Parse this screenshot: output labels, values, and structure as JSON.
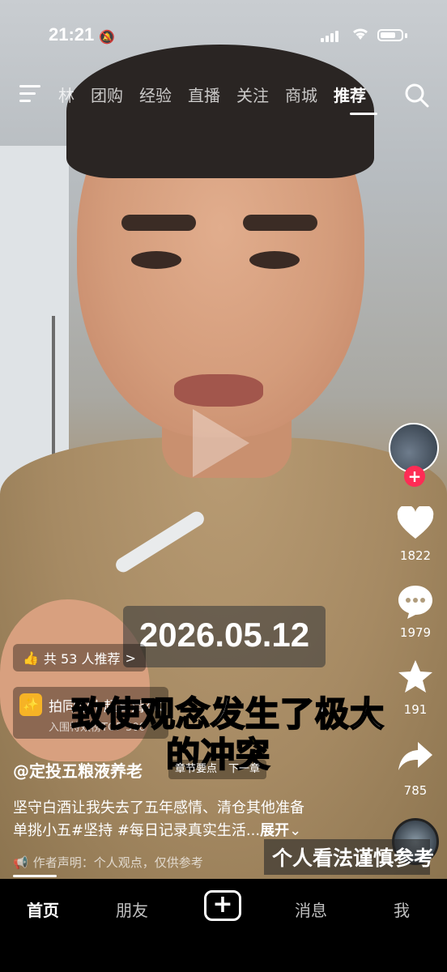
{
  "status_bar": {
    "time": "21:21",
    "battery_level": 0.75
  },
  "top_nav": {
    "tabs": [
      {
        "label": "林"
      },
      {
        "label": "团购"
      },
      {
        "label": "经验"
      },
      {
        "label": "直播"
      },
      {
        "label": "关注"
      },
      {
        "label": "商城"
      },
      {
        "label": "推荐",
        "active": true
      }
    ]
  },
  "video": {
    "date_overlay": "2026.05.12",
    "subtitle_line1": {
      "pre": "致使观",
      "highlight": "念",
      "post": "发生了极大"
    },
    "subtitle_line2": {
      "pre": "的",
      "highlight": "冲突"
    },
    "sticker": "个人看法谨慎参考"
  },
  "side_actions": {
    "like_count": "1822",
    "comment_count": "1979",
    "favorite_count": "191",
    "share_count": "785"
  },
  "recommend": {
    "label": "共 53 人推荐",
    "chevron": ">"
  },
  "template": {
    "title": "拍同款丨超高清4K",
    "subtitle": "入围特效榜TOP 500"
  },
  "post": {
    "author": "@定投五粮液养老",
    "chapter_points": "章节要点",
    "next_chapter": "下一章",
    "desc_line1": "坚守白酒让我失去了五年感情、清仓其他准备",
    "desc_line2": "单挑小五#坚持 #每日记录真实生活...",
    "expand": "展开",
    "disclaimer": "作者声明：个人观点，仅供参考"
  },
  "bottom_nav": {
    "home": "首页",
    "friends": "朋友",
    "create": "+",
    "messages": "消息",
    "me": "我"
  },
  "colors": {
    "accent_red": "#fe2c55",
    "subtitle_highlight": "#f5e23a",
    "template_icon": "#f6b326"
  }
}
